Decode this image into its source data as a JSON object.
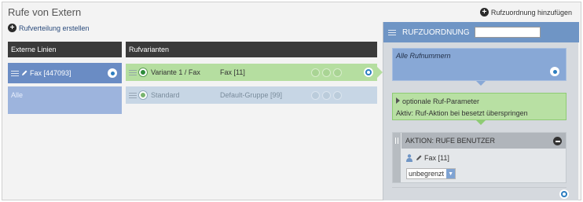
{
  "page": {
    "title": "Rufe von Extern",
    "add_assignment_label": "Rufzuordnung hinzufügen",
    "create_distribution_label": "Rufverteilung erstellen"
  },
  "columns": {
    "external_lines": "Externe Linien",
    "variants": "Rufvarianten"
  },
  "external_lines": [
    {
      "label": "Fax [447093]"
    },
    {
      "label": "Alle"
    }
  ],
  "variants": [
    {
      "name": "Variante 1 / Fax",
      "group": "Fax [11]"
    },
    {
      "name": "Standard",
      "group": "Default-Gruppe [99]"
    }
  ],
  "panel": {
    "title": "RUFZUORDNUNG",
    "name_value": "",
    "all_numbers_label": "Alle Rufnummern",
    "optional_params_label": "optionale Ruf-Parameter",
    "optional_params_detail": "Aktiv: Ruf-Aktion bei besetzt überspringen",
    "action_title": "AKTION: RUFE BENUTZER",
    "action_user": "Fax [11]",
    "action_select_value": "unbegrenzt"
  },
  "colors": {
    "accent_blue": "#6f95c5",
    "active_green": "#b5dea0",
    "header_dark": "#3a3a3a"
  }
}
